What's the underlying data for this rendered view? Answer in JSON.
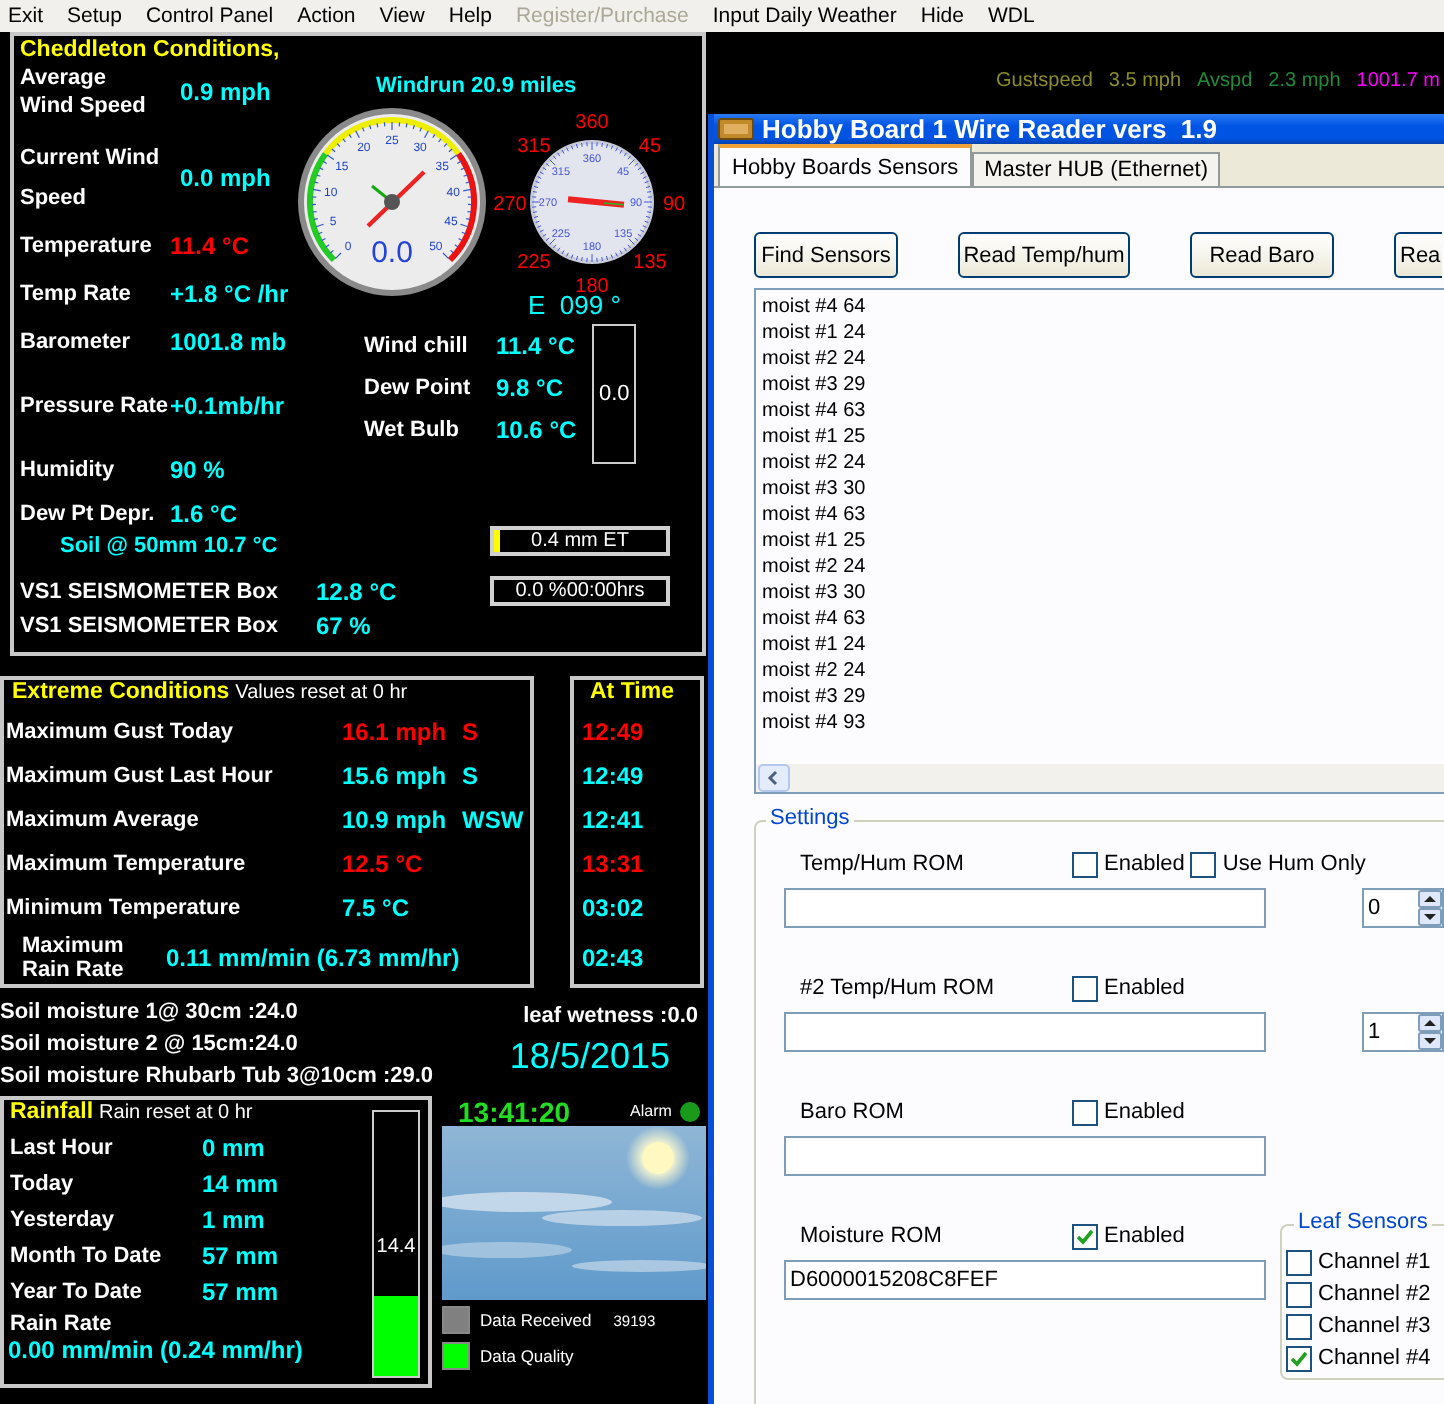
{
  "menu": [
    {
      "label": "Exit",
      "disabled": false
    },
    {
      "label": "Setup",
      "disabled": false
    },
    {
      "label": "Control Panel",
      "disabled": false
    },
    {
      "label": "Action",
      "disabled": false
    },
    {
      "label": "View",
      "disabled": false
    },
    {
      "label": "Help",
      "disabled": false
    },
    {
      "label": "Register/Purchase",
      "disabled": true
    },
    {
      "label": "Input Daily Weather",
      "disabled": false
    },
    {
      "label": "Hide",
      "disabled": false
    },
    {
      "label": "WDL",
      "disabled": false
    }
  ],
  "ticker": [
    {
      "text": "Gustspeed",
      "color": "#8c8c28"
    },
    {
      "text": "3.5 mph",
      "color": "#8c8c28"
    },
    {
      "text": "Avspd",
      "color": "#1e8c3c"
    },
    {
      "text": "2.3 mph",
      "color": "#1e8c3c"
    },
    {
      "text": "1001.7 m",
      "color": "#ff00ff"
    }
  ],
  "conditions": {
    "title": "Cheddleton Conditions,",
    "windrun": "Windrun 20.9 miles",
    "wind": [
      {
        "label": "Average Wind Speed",
        "value": "0.9 mph"
      },
      {
        "label": "Current Wind Speed",
        "value": "0.0 mph"
      }
    ],
    "readings": [
      {
        "label": "Temperature",
        "value": "11.4 °C",
        "color": "#ff0000"
      },
      {
        "label": "Temp Rate",
        "value": "+1.8 °C /hr",
        "color": "#00ffff"
      },
      {
        "label": "Barometer",
        "value": "1001.8 mb",
        "color": "#00ffff"
      },
      {
        "label": "Pressure Rate",
        "value": "+0.1mb/hr",
        "color": "#00ffff"
      },
      {
        "label": "Humidity",
        "value": "90 %",
        "color": "#00ffff"
      },
      {
        "label": "Dew Pt Depr.",
        "value": "1.6 °C",
        "color": "#00ffff"
      }
    ],
    "speed_gauge": {
      "scale": [
        "0",
        "5",
        "10",
        "15",
        "20",
        "25",
        "30",
        "35",
        "40",
        "45",
        "50"
      ],
      "reading": "0.0"
    },
    "direction_gauge": {
      "labels": [
        "360",
        "45",
        "90",
        "135",
        "180",
        "225",
        "270",
        "315"
      ],
      "dial": [
        "360",
        "45",
        "90",
        "135",
        "180",
        "225",
        "270",
        "315"
      ],
      "reading": "E  099 °"
    },
    "derived": [
      {
        "label": "Wind chill",
        "value": "11.4 °C"
      },
      {
        "label": "Dew Point",
        "value": "9.8 °C"
      },
      {
        "label": "Wet Bulb",
        "value": "10.6 °C"
      }
    ],
    "side_box": "0.0",
    "soil": "Soil @ 50mm 10.7 °C",
    "et": {
      "text": "0.4 mm ET",
      "level": 0.04
    },
    "sunshine": "0.0 %00:00hrs",
    "box_readings": [
      {
        "label": "VS1 SEISMOMETER Box",
        "value": "12.8 °C"
      },
      {
        "label": "VS1 SEISMOMETER Box",
        "value": "67 %"
      }
    ]
  },
  "extremes": {
    "title": "Extreme Conditions",
    "note": "Values reset at 0 hr",
    "time_title": "At Time",
    "rows": [
      {
        "label": "Maximum Gust Today",
        "value": "16.1 mph",
        "direction": "S",
        "time": "12:49",
        "color": "#ff0000"
      },
      {
        "label": "Maximum Gust Last Hour",
        "value": "15.6 mph",
        "direction": "S",
        "time": "12:49",
        "color": "#00ffff"
      },
      {
        "label": "Maximum Average",
        "value": "10.9 mph",
        "direction": "WSW",
        "time": "12:41",
        "color": "#00ffff"
      },
      {
        "label": "Maximum Temperature",
        "value": "12.5 °C",
        "time": "13:31",
        "color": "#ff0000"
      },
      {
        "label": "Minimum Temperature",
        "value": "7.5 °C",
        "time": "03:02",
        "color": "#00ffff"
      },
      {
        "label": "Maximum Rain Rate",
        "value": "0.11 mm/min (6.73 mm/hr)",
        "time": "02:43",
        "color": "#00ffff"
      }
    ]
  },
  "soil_moisture": [
    "Soil moisture 1@ 30cm :24.0",
    "Soil moisture 2 @ 15cm:24.0",
    "Soil moisture Rhubarb Tub 3@10cm :29.0"
  ],
  "leaf_wetness": "leaf wetness :0.0",
  "date": "18/5/2015",
  "rainfall": {
    "title": "Rainfall",
    "note": "Rain reset at 0 hr",
    "rows": [
      {
        "label": "Last Hour",
        "value": "0 mm"
      },
      {
        "label": "Today",
        "value": "14 mm"
      },
      {
        "label": "Yesterday",
        "value": "1 mm"
      },
      {
        "label": "Month To Date",
        "value": "57 mm"
      },
      {
        "label": "Year To Date",
        "value": "57 mm"
      }
    ],
    "rate_label": "Rain Rate",
    "rate": "0.00 mm/min (0.24 mm/hr)",
    "gauge": {
      "reading": "14.4",
      "level": 0.3
    }
  },
  "clock": "13:41:20",
  "alarm": {
    "label": "Alarm",
    "on": true
  },
  "status": [
    {
      "label": "Data Received",
      "value": "39193",
      "color": "#808080"
    },
    {
      "label": "Data Quality",
      "color": "#00ff00"
    }
  ],
  "dialog": {
    "title": "Hobby Board 1 Wire Reader vers  1.9",
    "tabs": [
      {
        "label": "Hobby Boards Sensors",
        "selected": true
      },
      {
        "label": "Master HUB (Ethernet)",
        "selected": false
      }
    ],
    "buttons": [
      "Find Sensors",
      "Read Temp/hum",
      "Read Baro",
      "Rea"
    ],
    "log": [
      "moist #4 64",
      "moist #1 24",
      "moist #2 24",
      "moist #3 29",
      "moist #4 63",
      "moist #1 25",
      "moist #2 24",
      "moist #3 30",
      "moist #4 63",
      "moist #1 25",
      "moist #2 24",
      "moist #3 30",
      "moist #4 63",
      "moist #1 24",
      "moist #2 24",
      "moist #3 29",
      "moist #4 93"
    ],
    "settings": {
      "title": "Settings",
      "roms": [
        {
          "label": "Temp/Hum ROM",
          "enabled_label": "Enabled",
          "enabled": false,
          "extra": {
            "label": "Use Hum Only",
            "checked": false
          },
          "spin": "0"
        },
        {
          "label": "#2 Temp/Hum ROM",
          "enabled_label": "Enabled",
          "enabled": false,
          "spin": "1"
        },
        {
          "label": "Baro ROM",
          "enabled_label": "Enabled",
          "enabled": false
        },
        {
          "label": "Moisture ROM",
          "enabled_label": "Enabled",
          "enabled": true,
          "value": "D6000015208C8FEF",
          "leaf_sensors": {
            "title": "Leaf Sensors",
            "channels": [
              {
                "label": "Channel #1",
                "checked": false
              },
              {
                "label": "Channel #2",
                "checked": false
              },
              {
                "label": "Channel #3",
                "checked": false
              },
              {
                "label": "Channel #4",
                "checked": true
              }
            ]
          }
        }
      ]
    }
  }
}
